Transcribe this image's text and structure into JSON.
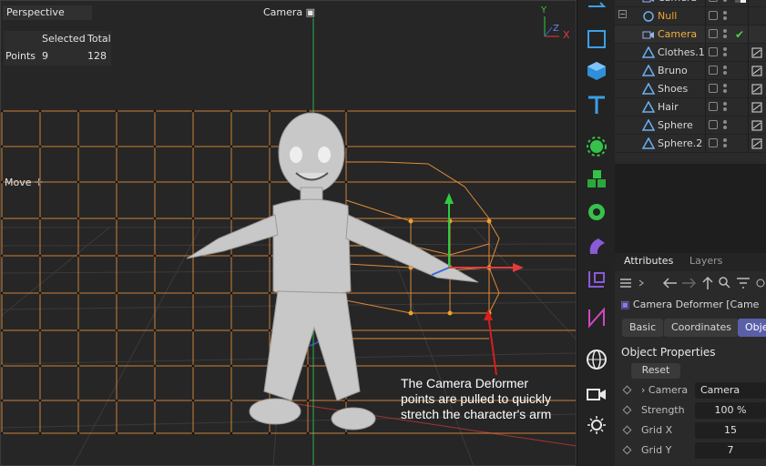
{
  "viewport": {
    "view_name": "Perspective",
    "camera_label": "Camera",
    "stats": {
      "header_selected": "Selected",
      "header_total": "Total",
      "row_label": "Points",
      "selected": "9",
      "total": "128"
    },
    "tool_label": "Move",
    "axis_y": "Y",
    "axis_z": "Z",
    "axis_x": "X",
    "annotation": [
      "The Camera Deformer",
      "points are pulled to quickly",
      "stretch the character's arm"
    ],
    "colors": {
      "grid": "#e08a3a",
      "y_axis": "#2ecc40",
      "x_axis": "#e03c3c",
      "point": "#f0a030"
    }
  },
  "toolbar": {
    "icons": [
      "spline-icon",
      "cube-outline-icon",
      "cube-icon",
      "text-icon",
      "generator-icon",
      "cloner-icon",
      "gear-generator-icon",
      "deformer-icon",
      "hierarchy-icon",
      "bend-icon",
      "globe-icon",
      "camera-icon",
      "light-icon"
    ]
  },
  "objects": {
    "rows": [
      {
        "name": "Camera",
        "icon": "camera-icon",
        "tag": "checker-tag-icon"
      },
      {
        "name": "Null",
        "icon": "null-icon",
        "expanded": true
      },
      {
        "name": "Camera",
        "icon": "camera-icon",
        "selected": true,
        "status": "checkmark-icon"
      },
      {
        "name": "Clothes.1",
        "icon": "mesh-icon",
        "tag": "material-tag-icon"
      },
      {
        "name": "Bruno",
        "icon": "mesh-icon",
        "tag": "material-tag-icon"
      },
      {
        "name": "Shoes",
        "icon": "mesh-icon",
        "tag": "material-tag-icon"
      },
      {
        "name": "Hair",
        "icon": "mesh-icon",
        "tag": "material-tag-icon"
      },
      {
        "name": "Sphere",
        "icon": "mesh-icon",
        "tag": "material-tag-icon"
      },
      {
        "name": "Sphere.2",
        "icon": "mesh-icon",
        "tag": "material-tag-icon"
      }
    ]
  },
  "attributes": {
    "tab_attributes": "Attributes",
    "tab_layers": "Layers",
    "title": "Camera Deformer [Came",
    "subtab_basic": "Basic",
    "subtab_coordinates": "Coordinates",
    "subtab_object": "Obje",
    "section": "Object Properties",
    "reset": "Reset",
    "props": [
      {
        "label": "Camera",
        "value": "Camera",
        "has_arrow": true
      },
      {
        "label": "Strength",
        "value": "100 %"
      },
      {
        "label": "Grid X",
        "value": "15"
      },
      {
        "label": "Grid Y",
        "value": "7"
      }
    ]
  }
}
